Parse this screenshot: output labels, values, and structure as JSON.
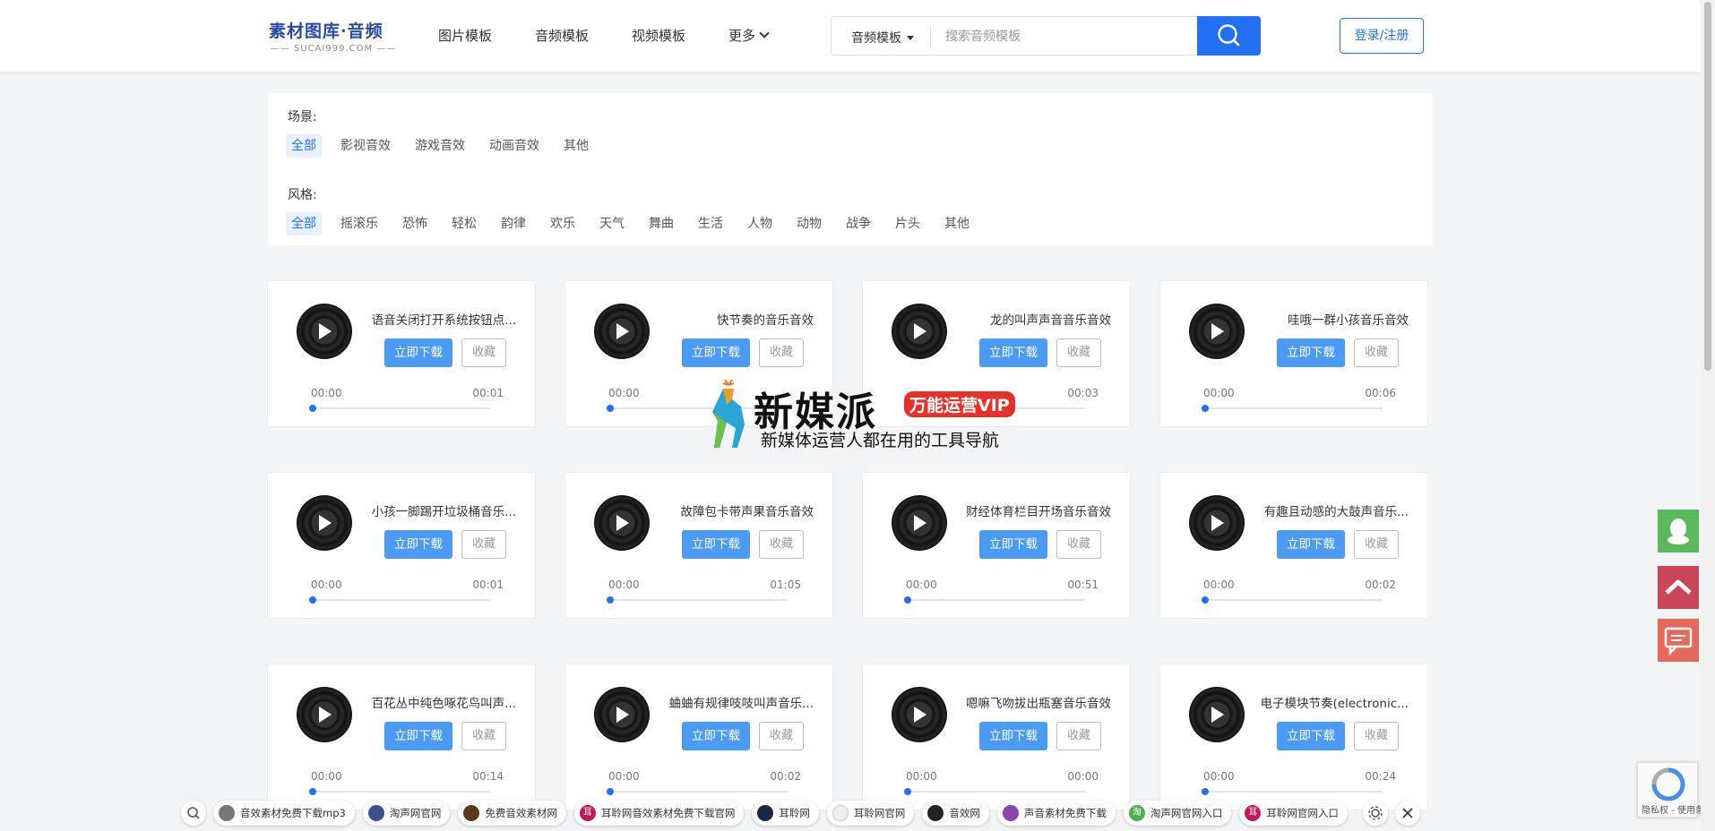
{
  "logo": {
    "cn": "素材图库·音频",
    "en": "SUCAI999.COM"
  },
  "nav": {
    "items": [
      "图片模板",
      "音频模板",
      "视频模板"
    ],
    "more": "更多"
  },
  "search": {
    "category": "音频模板",
    "placeholder": "搜索音频模板"
  },
  "login_label": "登录/注册",
  "filters": {
    "scene": {
      "label": "场景:",
      "tags": [
        "全部",
        "影视音效",
        "游戏音效",
        "动画音效",
        "其他"
      ],
      "active": "全部"
    },
    "style": {
      "label": "风格:",
      "tags": [
        "全部",
        "摇滚乐",
        "恐怖",
        "轻松",
        "韵律",
        "欢乐",
        "天气",
        "舞曲",
        "生活",
        "人物",
        "动物",
        "战争",
        "片头",
        "其他"
      ],
      "active": "全部"
    }
  },
  "card_labels": {
    "download": "立即下载",
    "favorite": "收藏"
  },
  "cards": [
    {
      "title": "语音关闭打开系统按钮点...",
      "start": "00:00",
      "end": "00:01"
    },
    {
      "title": "快节奏的音乐音效",
      "start": "00:00",
      "end": ""
    },
    {
      "title": "龙的叫声声音音乐音效",
      "start": "",
      "end": "00:03"
    },
    {
      "title": "哇哦一群小孩音乐音效",
      "start": "00:00",
      "end": "00:06"
    },
    {
      "title": "小孩一脚踢开垃圾桶音乐...",
      "start": "00:00",
      "end": "00:01"
    },
    {
      "title": "故障包卡带声果音乐音效",
      "start": "00:00",
      "end": "01:05"
    },
    {
      "title": "财经体育栏目开场音乐音效",
      "start": "00:00",
      "end": "00:51"
    },
    {
      "title": "有趣且动感的大鼓声音乐...",
      "start": "00:00",
      "end": "00:02"
    },
    {
      "title": "百花丛中纯色啄花鸟叫声...",
      "start": "00:00",
      "end": "00:14"
    },
    {
      "title": "蛐蛐有规律吱吱叫声音乐...",
      "start": "00:00",
      "end": "00:02"
    },
    {
      "title": "嗯嘛飞吻拔出瓶塞音乐音效",
      "start": "00:00",
      "end": "00:00"
    },
    {
      "title": "电子模块节奏(electronic...",
      "start": "00:00",
      "end": "00:24"
    }
  ],
  "watermark": {
    "name": "新媒派",
    "badge": "万能运营VIP",
    "tagline": "新媒体运营人都在用的工具导航"
  },
  "side_buttons": [
    "qq-icon",
    "back-to-top-icon",
    "feedback-icon"
  ],
  "recaptcha": {
    "text": "隐私权 - 使用条款"
  },
  "bottom_links": [
    "音效素材免费下载mp3",
    "淘声网官网",
    "免费音效素材网",
    "耳聆网音效素材免费下载官网",
    "耳聆网",
    "耳聆网官网",
    "音效网",
    "声音素材免费下载",
    "淘声网官网入口",
    "耳聆网官网入口"
  ],
  "colors": {
    "primary": "#2270f5",
    "download": "#4b9bf5",
    "side_green": "#5cb85c",
    "side_red": "#c9455a",
    "side_salmon": "#e8685a"
  }
}
